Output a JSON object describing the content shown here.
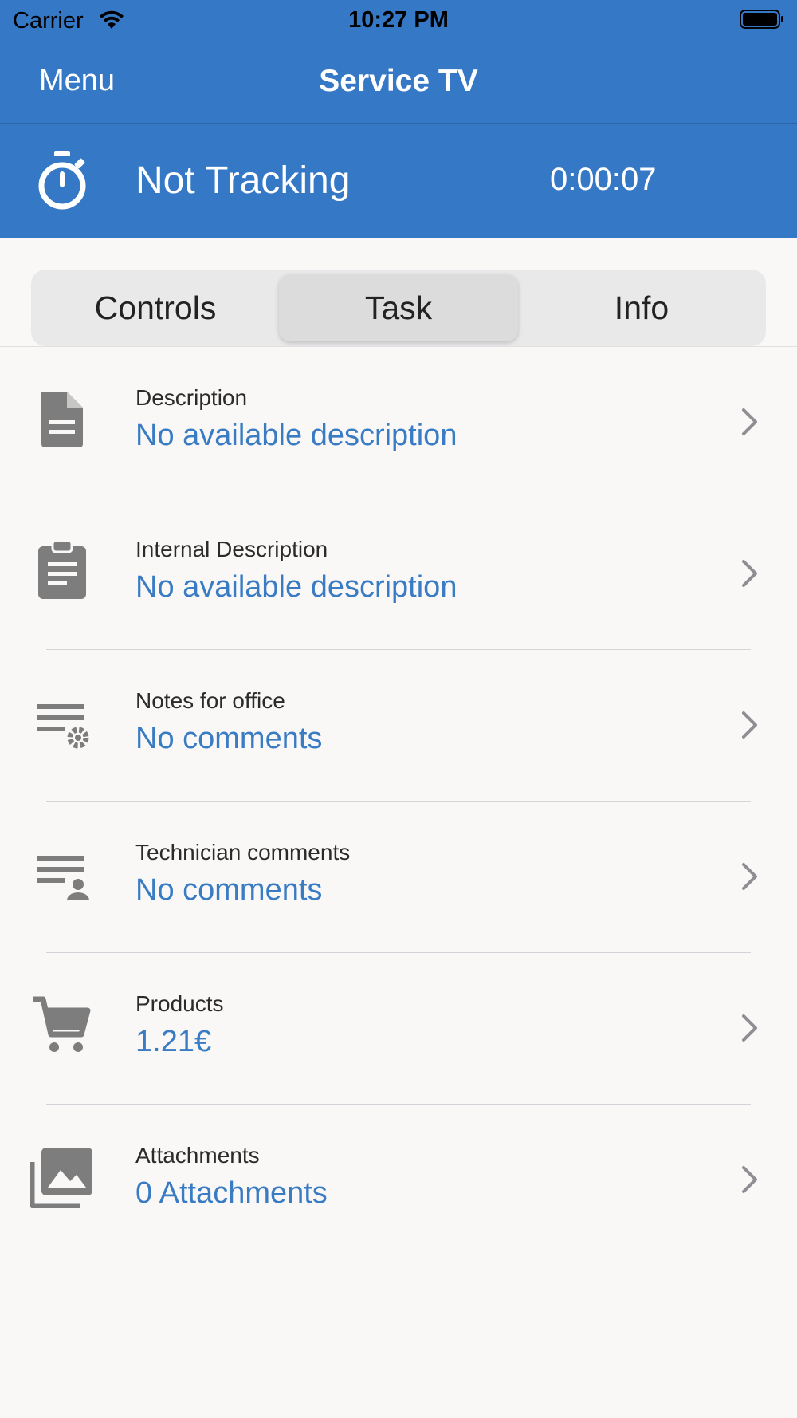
{
  "status_bar": {
    "carrier": "Carrier",
    "time": "10:27 PM"
  },
  "nav": {
    "menu_label": "Menu",
    "title": "Service TV"
  },
  "tracker": {
    "status": "Not Tracking",
    "elapsed": "0:00:07"
  },
  "tabs": [
    {
      "label": "Controls",
      "selected": false
    },
    {
      "label": "Task",
      "selected": true
    },
    {
      "label": "Info",
      "selected": false
    }
  ],
  "items": [
    {
      "icon": "document-icon",
      "label": "Description",
      "value": "No available description"
    },
    {
      "icon": "clipboard-icon",
      "label": "Internal Description",
      "value": "No available description"
    },
    {
      "icon": "notes-settings-icon",
      "label": "Notes for office",
      "value": "No comments"
    },
    {
      "icon": "notes-person-icon",
      "label": "Technician comments",
      "value": "No comments"
    },
    {
      "icon": "cart-icon",
      "label": "Products",
      "value": "1.21€"
    },
    {
      "icon": "photo-library-icon",
      "label": "Attachments",
      "value": "0 Attachments"
    }
  ],
  "colors": {
    "accent": "#3578c6",
    "link": "#3a7cc4",
    "icon": "#7d7d7d"
  }
}
